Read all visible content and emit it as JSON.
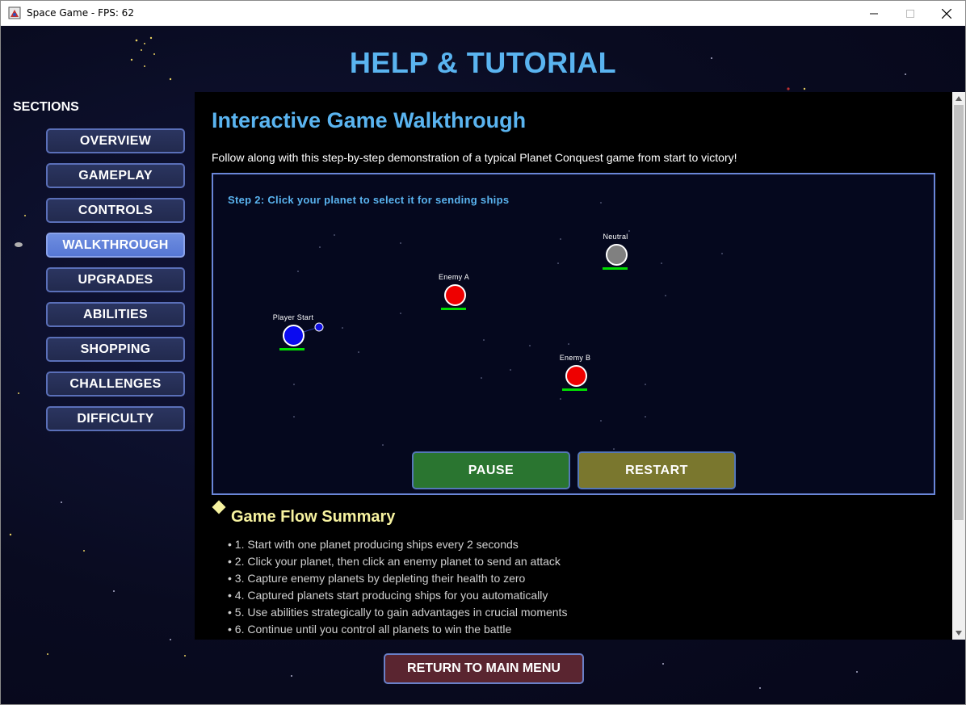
{
  "window": {
    "title": "Space Game - FPS: 62",
    "minimize_icon": "minimize-icon",
    "maximize_icon": "maximize-icon",
    "close_icon": "close-icon"
  },
  "header": {
    "title": "HELP & TUTORIAL"
  },
  "sidebar": {
    "label": "SECTIONS",
    "items": [
      {
        "label": "OVERVIEW",
        "active": false
      },
      {
        "label": "GAMEPLAY",
        "active": false
      },
      {
        "label": "CONTROLS",
        "active": false
      },
      {
        "label": "WALKTHROUGH",
        "active": true
      },
      {
        "label": "UPGRADES",
        "active": false
      },
      {
        "label": "ABILITIES",
        "active": false
      },
      {
        "label": "SHOPPING",
        "active": false
      },
      {
        "label": "CHALLENGES",
        "active": false
      },
      {
        "label": "DIFFICULTY",
        "active": false
      }
    ]
  },
  "walkthrough": {
    "title": "Interactive Game Walkthrough",
    "description": "Follow along with this step-by-step demonstration of a typical Planet Conquest game from start to victory!",
    "step": "Step 2: Click your planet to select it for sending ships",
    "planets": [
      {
        "label": "Player Start",
        "owner": "player",
        "color": "#0a0af0"
      },
      {
        "label": "Enemy A",
        "owner": "enemy",
        "color": "#ee0000"
      },
      {
        "label": "Neutral",
        "owner": "neutral",
        "color": "#808080"
      },
      {
        "label": "Enemy B",
        "owner": "enemy",
        "color": "#ee0000"
      }
    ],
    "health_bar_color": "#00e000",
    "pause_label": "PAUSE",
    "restart_label": "RESTART"
  },
  "summary": {
    "title": "Game Flow Summary",
    "items": [
      "• 1. Start with one planet producing ships every 2 seconds",
      "• 2. Click your planet, then click an enemy planet to send an attack",
      "• 3. Capture enemy planets by depleting their health to zero",
      "• 4. Captured planets start producing ships for you automatically",
      "• 5. Use abilities strategically to gain advantages in crucial moments",
      "• 6. Continue until you control all planets to win the battle"
    ]
  },
  "footer": {
    "return_label": "RETURN TO MAIN MENU"
  },
  "colors": {
    "accent_blue": "#5ab4f0",
    "summary_yellow": "#f7f3a0",
    "pause_green": "#2a7530",
    "restart_olive": "#7a772e",
    "return_maroon": "#5a2530"
  }
}
